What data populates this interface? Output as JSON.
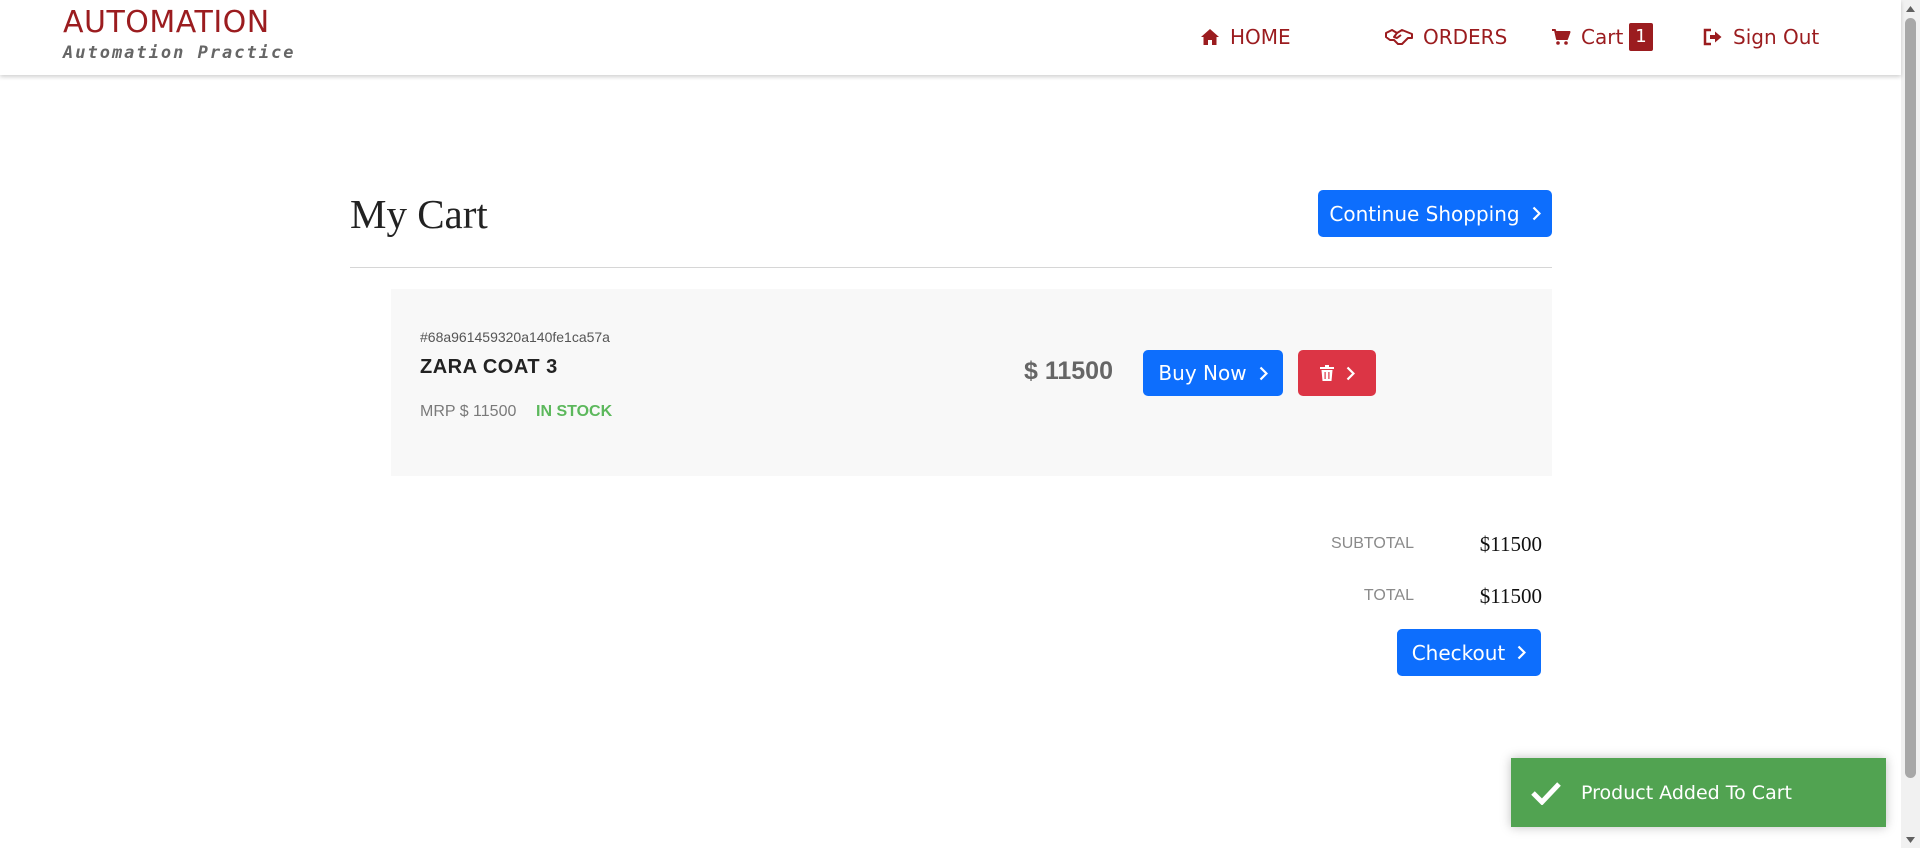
{
  "navbar": {
    "brand_title": "AUTOMATION",
    "brand_subtitle": "Automation Practice",
    "items": [
      {
        "label": "HOME",
        "icon": "home-icon"
      },
      {
        "label": "ORDERS",
        "icon": "handshake-icon"
      },
      {
        "label": "Cart",
        "icon": "cart-icon",
        "badge": "1"
      },
      {
        "label": "Sign Out",
        "icon": "sign-out-icon"
      }
    ]
  },
  "page": {
    "title": "My Cart",
    "continue_label": "Continue Shopping"
  },
  "cart": {
    "items": [
      {
        "id": "#68a961459320a140fe1ca57a",
        "name": "ZARA COAT 3",
        "mrp": "MRP $ 11500",
        "stock": "IN STOCK",
        "price": "$ 11500",
        "buy_label": "Buy Now"
      }
    ]
  },
  "summary": {
    "subtotal_label": "SUBTOTAL",
    "subtotal_value": "$11500",
    "total_label": "TOTAL",
    "total_value": "$11500",
    "checkout_label": "Checkout"
  },
  "toast": {
    "message": "Product Added To Cart"
  },
  "colors": {
    "brand": "#9b1c1f",
    "primary": "#0d6efd",
    "danger": "#dc3545",
    "success_toast": "#51a351",
    "in_stock": "#5cb85c"
  }
}
